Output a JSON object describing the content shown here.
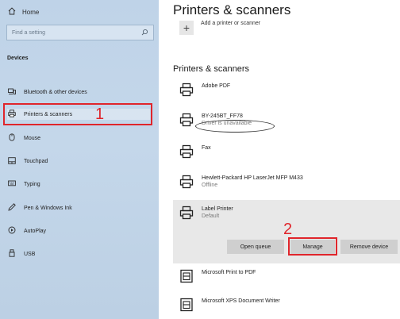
{
  "sidebar": {
    "home_label": "Home",
    "search_placeholder": "Find a setting",
    "section_title": "Devices",
    "items": [
      {
        "label": "Bluetooth & other devices",
        "icon": "bluetooth-devices-icon"
      },
      {
        "label": "Printers & scanners",
        "icon": "printer-icon",
        "selected": true
      },
      {
        "label": "Mouse",
        "icon": "mouse-icon"
      },
      {
        "label": "Touchpad",
        "icon": "touchpad-icon"
      },
      {
        "label": "Typing",
        "icon": "keyboard-icon"
      },
      {
        "label": "Pen & Windows Ink",
        "icon": "pen-icon"
      },
      {
        "label": "AutoPlay",
        "icon": "autoplay-icon"
      },
      {
        "label": "USB",
        "icon": "usb-icon"
      }
    ]
  },
  "main": {
    "page_title": "Printers & scanners",
    "add_label": "Add a printer or scanner",
    "section_title": "Printers & scanners",
    "printers": [
      {
        "name": "Adobe PDF",
        "status": ""
      },
      {
        "name": "BY-245BT_FF78",
        "status": "Driver is unavailable"
      },
      {
        "name": "Fax",
        "status": ""
      },
      {
        "name": "Hewlett-Packard HP LaserJet MFP M433",
        "status": "Offline"
      },
      {
        "name": "Label Printer",
        "status": "Default"
      },
      {
        "name": "Microsoft Print to PDF",
        "status": ""
      },
      {
        "name": "Microsoft XPS Document Writer",
        "status": ""
      }
    ],
    "buttons": {
      "open_queue": "Open queue",
      "manage": "Manage",
      "remove_device": "Remove device"
    }
  },
  "annotations": {
    "step1": "1",
    "step2": "2"
  },
  "colors": {
    "annotation": "#e0252b",
    "sidebar_bg": "#c4d7ea",
    "selected_panel": "#e8e8e8"
  }
}
